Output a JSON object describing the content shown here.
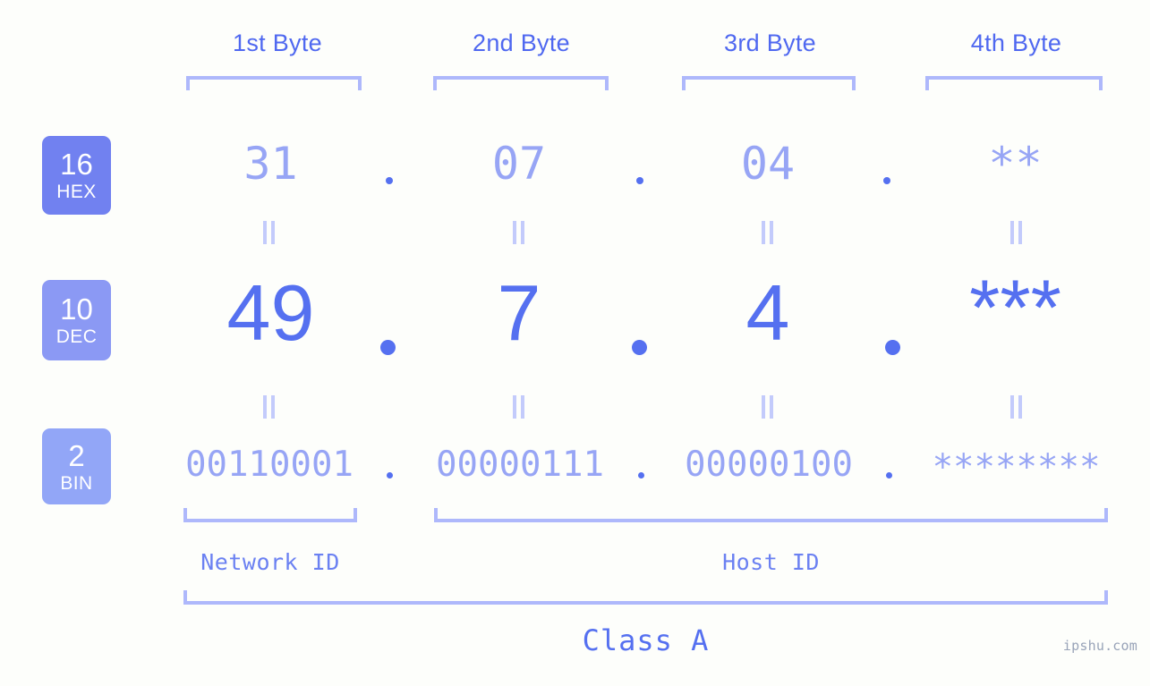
{
  "meta": {
    "background_color": "#fdfefb",
    "accent_color": "#5570f0",
    "light_accent_color": "#aeb8fb",
    "muted_value_color": "#97a5f5",
    "watermark": "ipshu.com"
  },
  "byte_headers": [
    {
      "label": "1st Byte"
    },
    {
      "label": "2nd Byte"
    },
    {
      "label": "3rd Byte"
    },
    {
      "label": "4th Byte"
    }
  ],
  "bases": [
    {
      "number": "16",
      "abbr": "HEX",
      "color": "#7181f0"
    },
    {
      "number": "10",
      "abbr": "DEC",
      "color": "#8b99f4"
    },
    {
      "number": "2",
      "abbr": "BIN",
      "color": "#92a6f7"
    }
  ],
  "rows": {
    "hex": {
      "values": [
        "31",
        "07",
        "04",
        "**"
      ]
    },
    "dec": {
      "values": [
        "49",
        "7",
        "4",
        "***"
      ]
    },
    "bin": {
      "values": [
        "00110001",
        "00000111",
        "00000100",
        "********"
      ]
    }
  },
  "separators": {
    "hex": [
      ".",
      ".",
      "."
    ],
    "dec": [
      ".",
      ".",
      "."
    ],
    "bin": [
      ".",
      ".",
      "."
    ]
  },
  "equals_marks": {
    "symbol": "=",
    "count_per_row": 4
  },
  "regions": [
    {
      "label": "Network ID"
    },
    {
      "label": "Host ID"
    }
  ],
  "class": {
    "label": "Class A"
  }
}
